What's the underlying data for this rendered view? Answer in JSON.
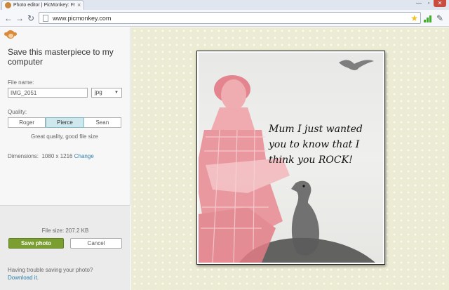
{
  "browser": {
    "tab_title": "Photo editor | PicMonkey: Fr",
    "tab_close": "×",
    "url": "www.picmonkey.com",
    "window_controls": [
      "—",
      "▫",
      "✕"
    ]
  },
  "panel": {
    "heading": "Save this masterpiece to my computer",
    "file_name_label": "File name:",
    "file_name_value": "IMG_2051",
    "format_value": "jpg",
    "quality_label": "Quality:",
    "quality_options": [
      "Roger",
      "Pierce",
      "Sean"
    ],
    "quality_selected": "Pierce",
    "quality_description": "Great quality, good file size",
    "dimensions_label": "Dimensions:",
    "dimensions_value": "1080 x 1216",
    "dimensions_change": "Change",
    "file_size": "File size: 207.2 KB",
    "save_label": "Save photo",
    "cancel_label": "Cancel",
    "help_text": "Having trouble saving your photo?",
    "help_link": "Download it."
  },
  "photo": {
    "caption": "Mum I just wanted you to know that I think you ROCK!"
  },
  "colors": {
    "accent_green": "#7a9e2f",
    "link_blue": "#2f7fa8",
    "selected_quality": "#cfe8ee",
    "canvas_bg": "#ecebd4"
  }
}
